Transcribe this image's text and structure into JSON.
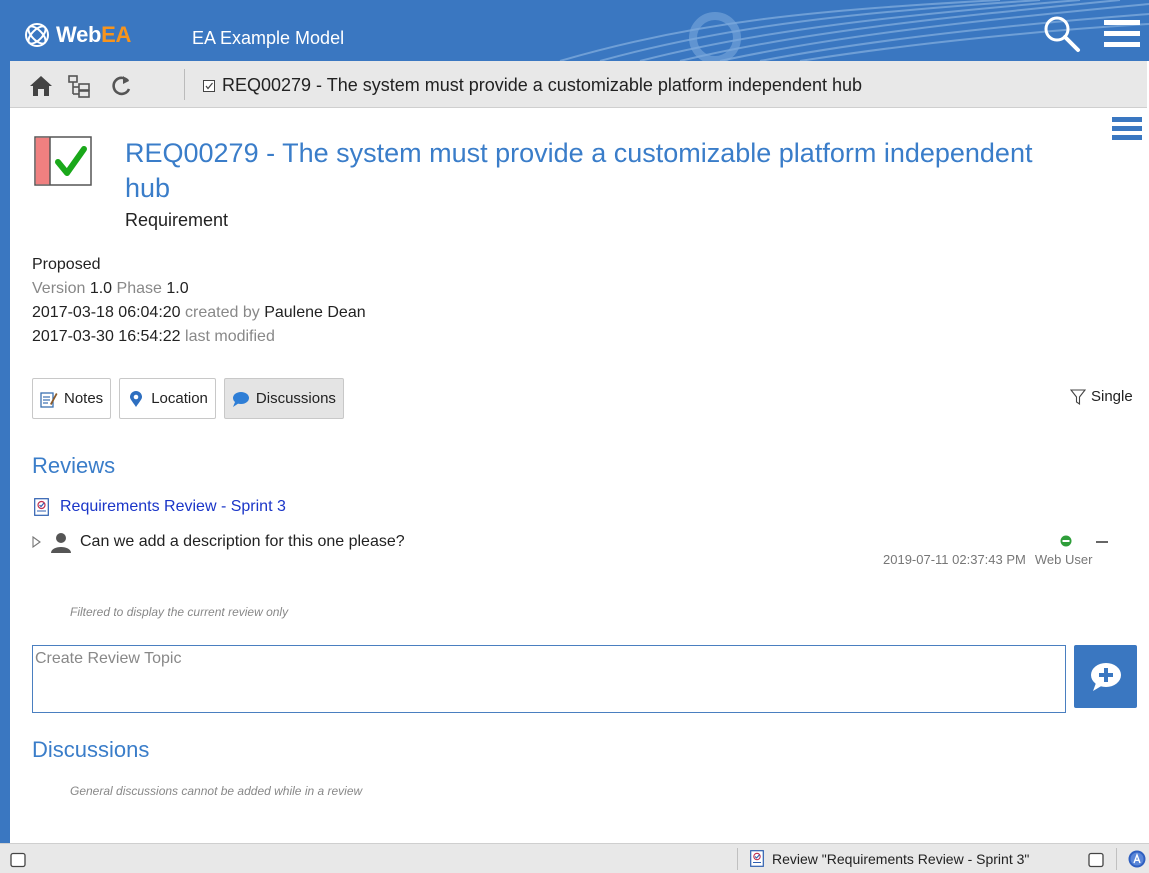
{
  "header": {
    "logo_web": "Web",
    "logo_ea": "EA",
    "model_name": "EA Example Model",
    "icons": [
      "logo-icon",
      "search-icon",
      "hamburger-menu-icon"
    ]
  },
  "toolbar": {
    "icons": [
      "home-icon",
      "tree-icon",
      "refresh-icon",
      "requirement-icon"
    ],
    "breadcrumb": "REQ00279 - The system must provide a customizable platform independent hub"
  },
  "element": {
    "title": "REQ00279 - The system must provide a customizable platform independent hub",
    "type": "Requirement",
    "status": "Proposed",
    "version_label": "Version",
    "version": "1.0",
    "phase_label": "Phase",
    "phase": "1.0",
    "created_date": "2017-03-18 06:04:20",
    "created_by_label": "created by",
    "author": "Paulene Dean",
    "modified_date": "2017-03-30 16:54:22",
    "modified_label": "last modified",
    "icon_colors": {
      "bar": "#f08080",
      "check": "#1aa81a"
    }
  },
  "tabs": [
    {
      "label": "Notes",
      "icon": "notes-icon",
      "active": false
    },
    {
      "label": "Location",
      "icon": "location-pin-icon",
      "active": false
    },
    {
      "label": "Discussions",
      "icon": "chat-bubble-icon",
      "active": true
    }
  ],
  "filter": {
    "label": "Single",
    "icon": "filter-icon"
  },
  "reviews": {
    "heading": "Reviews",
    "review_name": "Requirements Review - Sprint 3",
    "topic": {
      "text": "Can we add a description for this one please?",
      "status_color": "#2e9e3a",
      "timestamp": "2019-07-11 02:37:43 PM",
      "author": "Web User"
    },
    "filter_hint": "Filtered to display the current review only",
    "input_placeholder": "Create Review Topic"
  },
  "discussions": {
    "heading": "Discussions",
    "hint": "General discussions cannot be added while in a review"
  },
  "statusbar": {
    "review_text": "Review \"Requirements Review - Sprint 3\""
  },
  "colors": {
    "brand_blue": "#3a77c1",
    "link_blue": "#1a35c8",
    "heading_blue": "#3a7dc9",
    "accent_orange": "#f7941d"
  }
}
